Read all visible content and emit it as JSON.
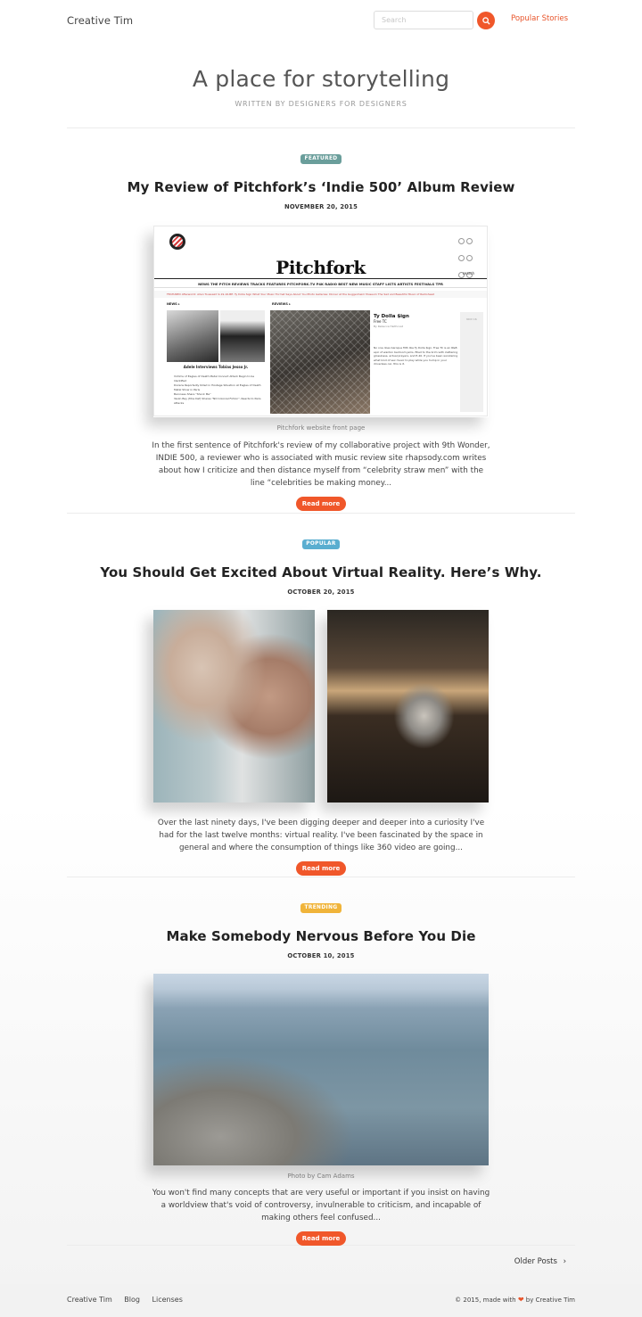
{
  "nav": {
    "brand": "Creative Tim",
    "search_placeholder": "Search",
    "popular_link": "Popular Stories"
  },
  "hero": {
    "title": "A place for storytelling",
    "subtitle": "WRITTEN BY DESIGNERS FOR DESIGNERS"
  },
  "posts": [
    {
      "badge": "FEATURED",
      "badge_color": "#6a9e9b",
      "title": "My Review of Pitchfork’s ‘Indie 500’ Album Review",
      "date": "NOVEMBER 20, 2015",
      "image_caption": "Pitchfork website front page",
      "excerpt": "In the first sentence of Pitchfork's review of my collaborative project with 9th Wonder, INDIE 500, a reviewer who is associated with music review site rhapsody.com writes about how I criticize and then distance myself from “celebrity straw men” with the line “celebrities be making money...",
      "read_more": "Read more",
      "pitchfork": {
        "wordmark": "Pitchfork",
        "search": "search",
        "nav": "NEWS  THE PITCH  REVIEWS  TRACKS  FEATURES  PITCHFORK.TV  P4K RADIO  BEST NEW MUSIC  STAFF LISTS  ARTISTS  FESTIVALS  TPR",
        "featured_bar": "FEATURED   Afterworld: Allen Toussaint   9-19-16-BE: Ty Dolla Sign   What Your Music Format Says About You   Photo Galleries: Dinner at the Guggenheim Museum   The Sad and Beautiful Music of Radiohead",
        "news_label": "NEWS ▸",
        "reviews_label": "REVIEWS ▸",
        "news_headline": "Adele Interviews Tobias Jesso Jr.",
        "news_items": [
          "Victims of Eagles of Death Metal Concert Attack Begin to be Identified",
          "Dozens Reportedly Killed in Hostage Situation at Eagles of Death Metal Show in Paris",
          "Baroness Share \"Shock Me\"",
          "Yasiin Bey (Mos Def) Shares \"NO Colonial Fiction\", Reacts to Paris Attacks"
        ],
        "review_artist": "Ty Dolla $ign",
        "review_album": "Free TC",
        "review_author": "By Rebecca Haithcoat",
        "review_text": "No one does baroque filth like Ty Dolla $ign. Free TC is an R&B epic of wanton bedroom jams, filled to the brim with clattering glossiness, actual prayers, and E-40. If you've been wondering what kind of sex music to play while you hump in your driverless car, this is it.",
        "side_date": "NOV 16"
      }
    },
    {
      "badge": "POPULAR",
      "badge_color": "#5aaed0",
      "title": "You Should Get Excited About Virtual Reality. Here’s Why.",
      "date": "OCTOBER 20, 2015",
      "excerpt": "Over the last ninety days, I've been digging deeper and deeper into a curiosity I've had for the last twelve months: virtual reality. I've been fascinated by the space in general and where the consumption of things like 360 video are going...",
      "read_more": "Read more"
    },
    {
      "badge": "TRENDING",
      "badge_color": "#f0b43a",
      "title": "Make Somebody Nervous Before You Die",
      "date": "OCTOBER 10, 2015",
      "image_caption": "Photo by Cam Adams",
      "excerpt": "You won't find many concepts that are very useful or important if you insist on having a worldview that's void of controversy, invulnerable to criticism, and incapable of making others feel confused...",
      "read_more": "Read more"
    }
  ],
  "pagination": {
    "older_label": "Older Posts"
  },
  "footer": {
    "links": [
      "Creative Tim",
      "Blog",
      "Licenses"
    ],
    "copyright_prefix": "© 2015, made with",
    "copyright_suffix": "by Creative Tim"
  },
  "colors": {
    "accent": "#f0572a"
  }
}
